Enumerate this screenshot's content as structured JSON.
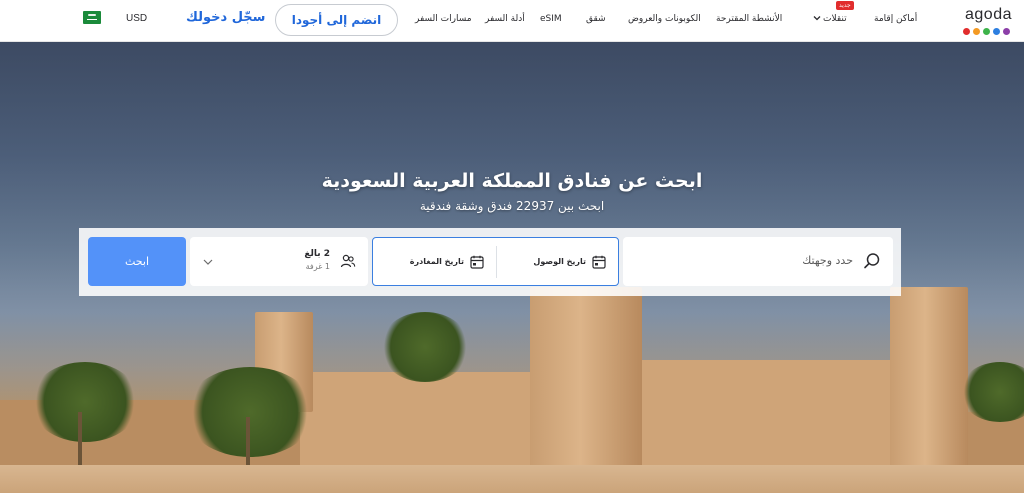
{
  "nav": {
    "logo_text": "agoda",
    "logo_dots": [
      "#e12d2d",
      "#f39a24",
      "#3db34a",
      "#2d7fe0",
      "#8c3fa8"
    ],
    "items": {
      "stays": "أماكن إقامة",
      "flights": "تنقلات",
      "new_badge": "جديد",
      "activities": "الأنشطة المقترحة",
      "coupons": "الكوبونات والعروض",
      "apartments": "شقق",
      "esim": "eSIM",
      "guides": "أدلة السفر",
      "routes": "مسارات السفر"
    },
    "join_label": "انضم إلى أجودا",
    "signin_label": "سجّل دخولك",
    "currency": "USD",
    "flag_icon": "saudi-flag-icon"
  },
  "hero": {
    "title": "ابحث عن فنادق المملكة العربية السعودية",
    "subtitle": "ابحث بين 22937 فندق وشقة فندقية"
  },
  "search": {
    "destination_placeholder": "حدد وجهتك",
    "checkin_label": "تاريخ الوصول",
    "checkout_label": "تاريخ المغادرة",
    "adults": "2 بالغ",
    "rooms": "1 غرفة",
    "search_button": "ابحث"
  },
  "colors": {
    "brand_blue": "#2067da",
    "search_button": "#5392f9",
    "active_border": "#3b7fe0"
  }
}
